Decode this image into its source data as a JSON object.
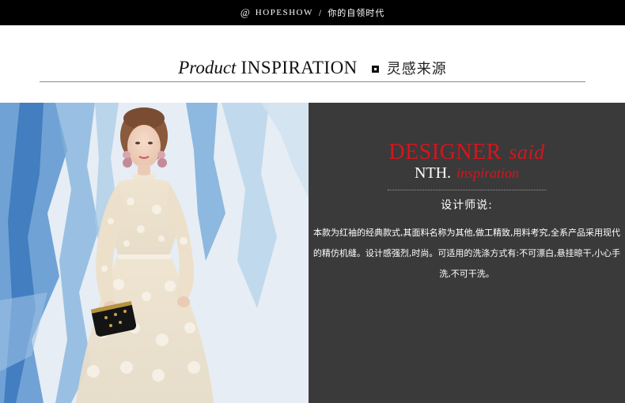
{
  "top_bar": {
    "at_symbol": "@",
    "brand": "HOPESHOW",
    "separator": "/",
    "slogan": "你的自领时代"
  },
  "section_heading": {
    "product": "Product",
    "inspiration": "INSPIRATION",
    "icon": "square-bullet-icon",
    "chinese": "灵感来源"
  },
  "designer": {
    "title_main": "DESIGNER",
    "title_said": "said",
    "nth": "NTH.",
    "nth_inspiration": "inspiration",
    "label": "设计师说:",
    "description": "本款为红袖的经典款式,其面料名称为其他,做工精致,用料考究,全系产品采用现代的精仿机缝。设计感强烈,时尚。可适用的洗涤方式有:不可漂白,悬挂晾干,小心手洗,不可干洗。"
  },
  "colors": {
    "top_bar_bg": "#000000",
    "accent_red": "#d8141d",
    "panel_dark": "#3a3a3a",
    "backdrop_blue": "#3f7ec4"
  }
}
